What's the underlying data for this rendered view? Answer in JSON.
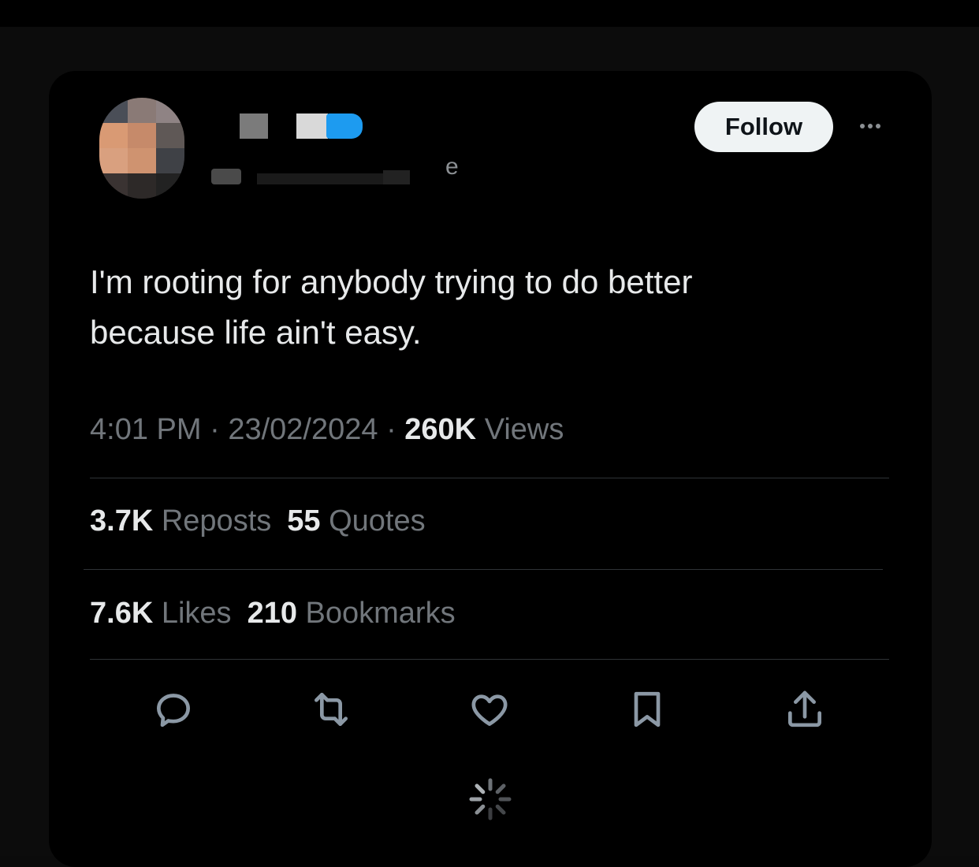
{
  "tweet": {
    "text_line1": "I'm rooting for anybody trying to do better",
    "text_line2": "because life ain't easy.",
    "handle_visible_fragment": "e"
  },
  "header": {
    "follow_label": "Follow"
  },
  "meta": {
    "time": "4:01 PM",
    "date": "23/02/2024",
    "separator": "·",
    "views_count": "260K",
    "views_label": "Views"
  },
  "stats": {
    "reposts_count": "3.7K",
    "reposts_label": "Reposts",
    "quotes_count": "55",
    "quotes_label": "Quotes",
    "likes_count": "7.6K",
    "likes_label": "Likes",
    "bookmarks_count": "210",
    "bookmarks_label": "Bookmarks"
  },
  "actions": [
    "reply-icon",
    "repost-icon",
    "like-icon",
    "bookmark-icon",
    "share-icon"
  ],
  "colors": {
    "background": "#000000",
    "text_primary": "#e7e9ea",
    "text_secondary": "#71767b",
    "divider": "#2f3336",
    "verified_badge": "#1d9bf0"
  }
}
